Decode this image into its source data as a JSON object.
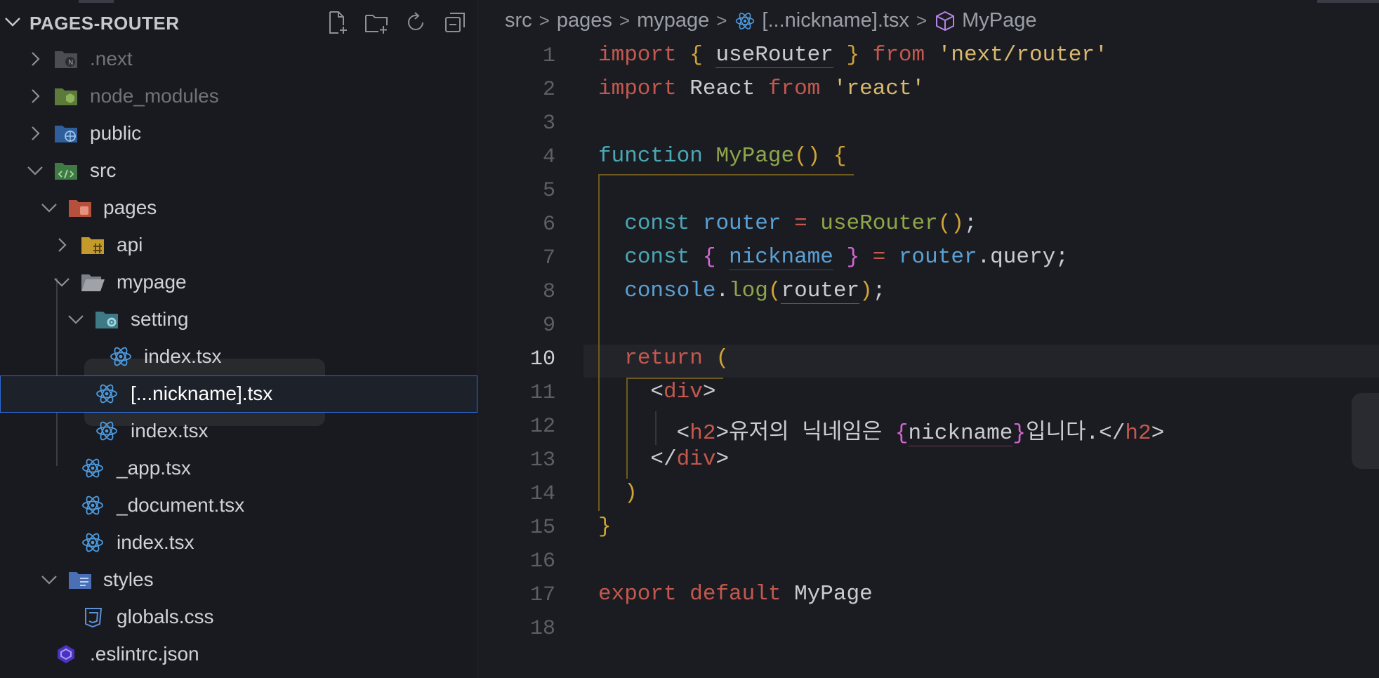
{
  "explorer": {
    "title": "PAGES-ROUTER",
    "actions": [
      {
        "name": "new-file-icon"
      },
      {
        "name": "new-folder-icon"
      },
      {
        "name": "refresh-icon"
      },
      {
        "name": "collapse-all-icon"
      }
    ],
    "items": [
      {
        "label": ".next",
        "depth": 0,
        "type": "folder",
        "expanded": false,
        "icon": "next-folder-icon",
        "dim": true
      },
      {
        "label": "node_modules",
        "depth": 0,
        "type": "folder",
        "expanded": false,
        "icon": "node-folder-icon",
        "dim": true
      },
      {
        "label": "public",
        "depth": 0,
        "type": "folder",
        "expanded": false,
        "icon": "public-folder-icon"
      },
      {
        "label": "src",
        "depth": 0,
        "type": "folder",
        "expanded": true,
        "icon": "src-folder-icon"
      },
      {
        "label": "pages",
        "depth": 1,
        "type": "folder",
        "expanded": true,
        "icon": "pages-folder-icon"
      },
      {
        "label": "api",
        "depth": 2,
        "type": "folder",
        "expanded": false,
        "icon": "api-folder-icon"
      },
      {
        "label": "mypage",
        "depth": 2,
        "type": "folder",
        "expanded": true,
        "icon": "folder-open-icon"
      },
      {
        "label": "setting",
        "depth": 3,
        "type": "folder",
        "expanded": true,
        "icon": "setting-folder-icon"
      },
      {
        "label": "index.tsx",
        "depth": 4,
        "type": "file",
        "icon": "react-icon"
      },
      {
        "label": "[...nickname].tsx",
        "depth": 3,
        "type": "file",
        "icon": "react-icon",
        "selected": true
      },
      {
        "label": "index.tsx",
        "depth": 3,
        "type": "file",
        "icon": "react-icon"
      },
      {
        "label": "_app.tsx",
        "depth": 2,
        "type": "file",
        "icon": "react-icon"
      },
      {
        "label": "_document.tsx",
        "depth": 2,
        "type": "file",
        "icon": "react-icon"
      },
      {
        "label": "index.tsx",
        "depth": 2,
        "type": "file",
        "icon": "react-icon"
      },
      {
        "label": "styles",
        "depth": 1,
        "type": "folder",
        "expanded": true,
        "icon": "styles-folder-icon"
      },
      {
        "label": "globals.css",
        "depth": 2,
        "type": "file",
        "icon": "css-icon"
      },
      {
        "label": ".eslintrc.json",
        "depth": 0,
        "type": "file",
        "icon": "eslint-icon"
      }
    ]
  },
  "breadcrumb": {
    "parts": [
      "src",
      "pages",
      "mypage"
    ],
    "file": "[...nickname].tsx",
    "symbol": "MyPage"
  },
  "editor": {
    "active_line": 10,
    "line_numbers": [
      "1",
      "2",
      "3",
      "4",
      "5",
      "6",
      "7",
      "8",
      "9",
      "10",
      "11",
      "12",
      "13",
      "14",
      "15",
      "16",
      "17",
      "18"
    ],
    "tokens": {
      "import": "import",
      "from": "from",
      "useRouter": "useRouter",
      "next_router": "'next/router'",
      "React": "React",
      "react": "'react'",
      "function": "function",
      "MyPage": "MyPage",
      "const": "const",
      "router": "router",
      "nickname": "nickname",
      "query": "query",
      "console": "console",
      "log": "log",
      "return": "return",
      "div": "div",
      "h2": "h2",
      "korean_text": "유저의 닉네임은 ",
      "korean_after": "입니다.",
      "export": "export",
      "default": "default"
    }
  },
  "colors": {
    "accent": "#2d6bd9",
    "keyword": "#c4584e",
    "function_keyword": "#4aa8b5",
    "function_name": "#8fa64a",
    "bracket": "#d1a435",
    "variable": "#5aa1d6",
    "string": "#d9b96d",
    "jsx_brace": "#d466d4"
  }
}
